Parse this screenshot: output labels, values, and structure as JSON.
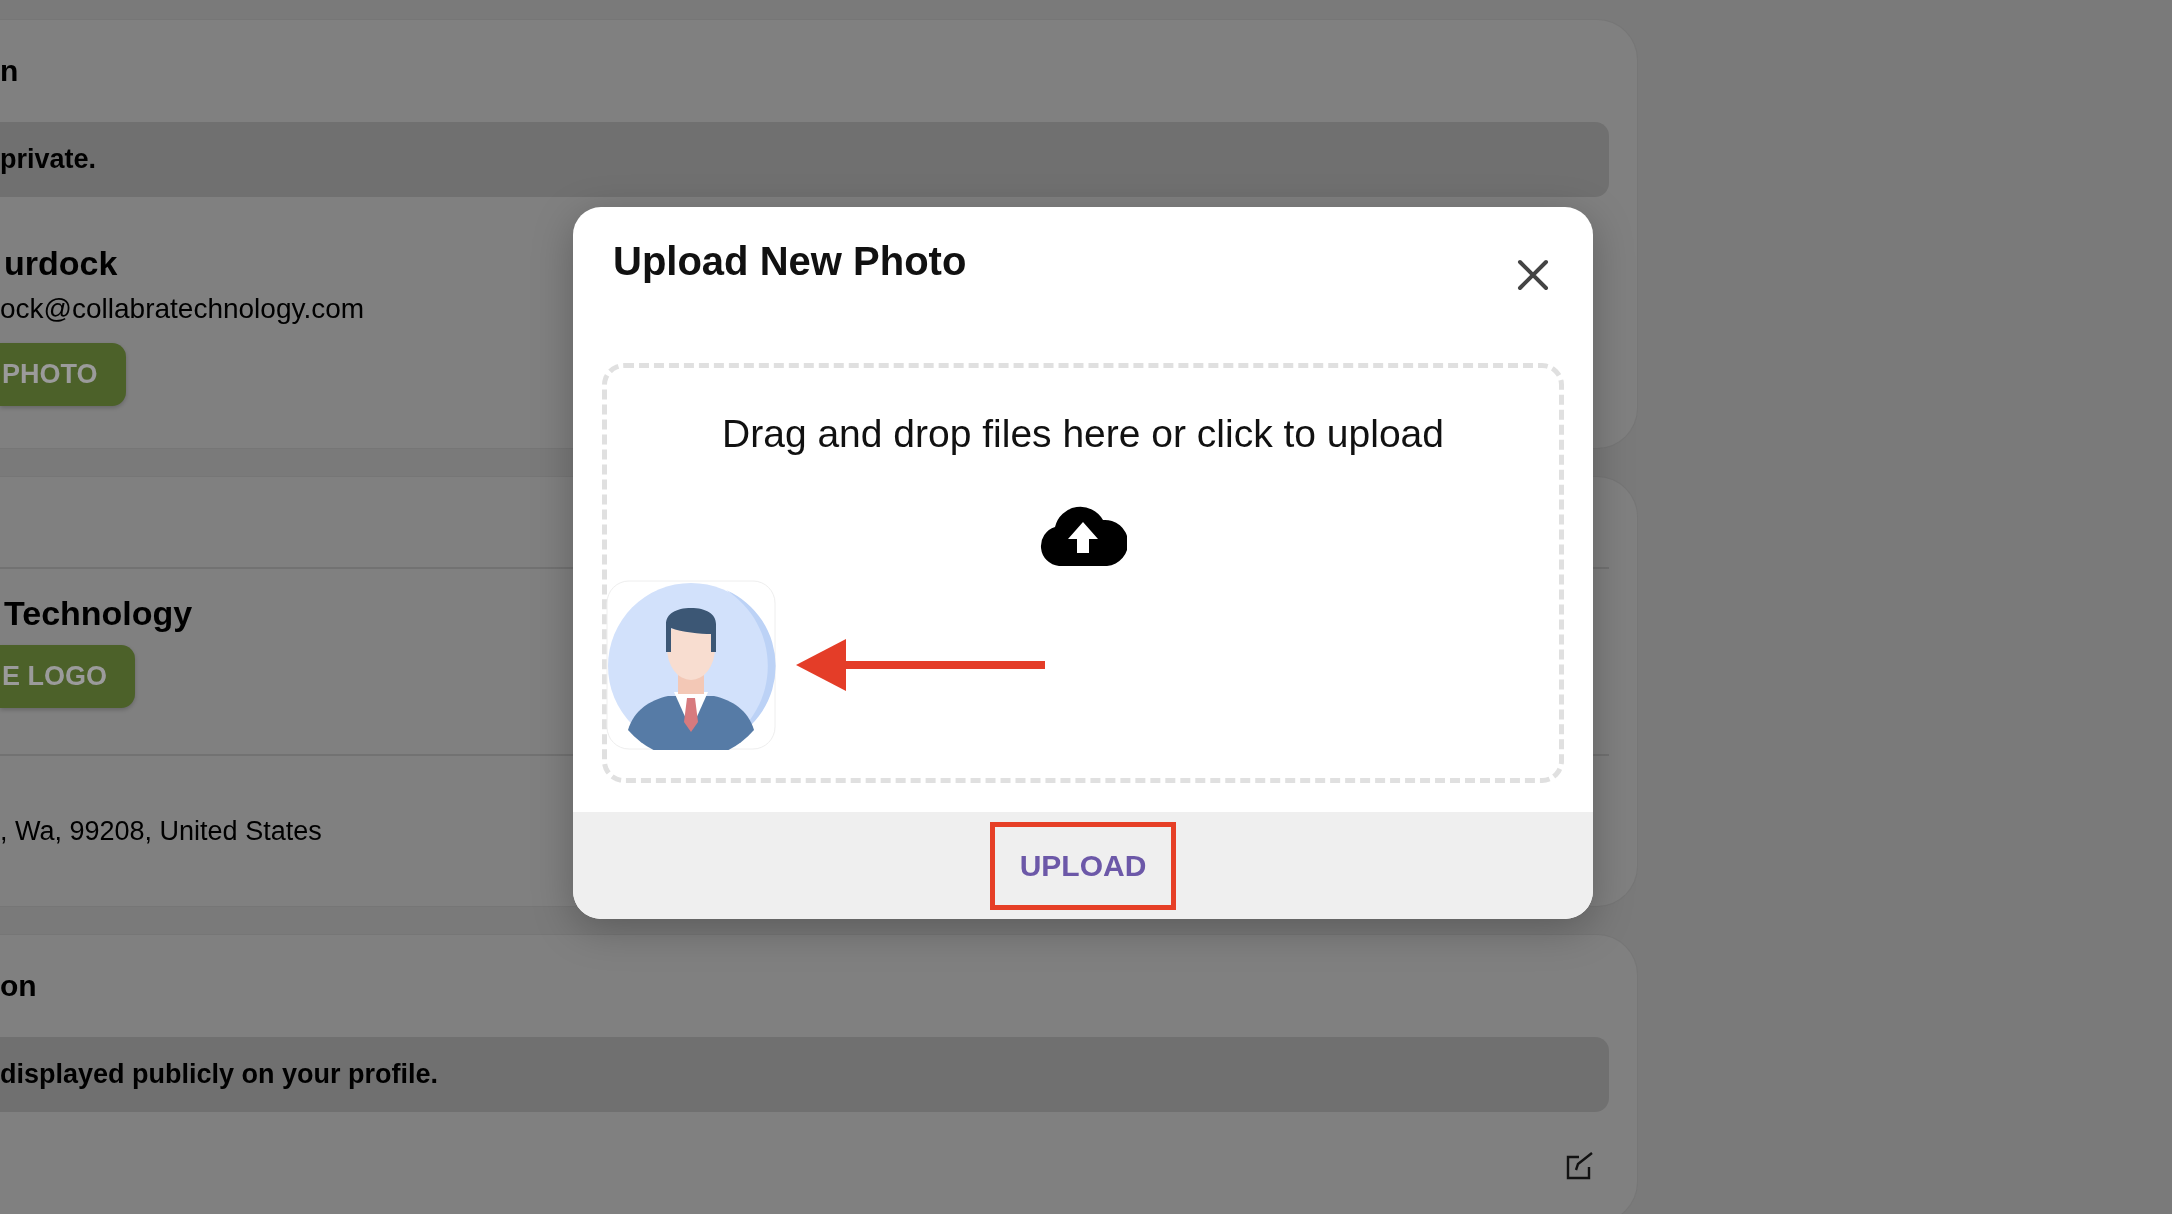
{
  "background_cards": [
    {
      "rows": [
        {
          "kind": "heading",
          "text": "n"
        },
        {
          "kind": "notice",
          "text": "private."
        },
        {
          "kind": "profile",
          "title": "urdock",
          "subtitle": "ock@collabratechnology.com",
          "button": "PHOTO"
        }
      ]
    },
    {
      "rows": [
        {
          "kind": "blank"
        },
        {
          "kind": "profile",
          "title": "Technology",
          "button": "E LOGO"
        },
        {
          "kind": "text",
          "text": ", Wa, 99208, United States"
        }
      ]
    },
    {
      "rows": [
        {
          "kind": "heading",
          "text": "on"
        },
        {
          "kind": "notice",
          "text": "displayed publicly on your profile."
        },
        {
          "kind": "edit"
        }
      ]
    }
  ],
  "modal": {
    "title": "Upload New Photo",
    "dropzone_text": "Drag and drop files here or click to upload",
    "upload_button": "UPLOAD"
  }
}
